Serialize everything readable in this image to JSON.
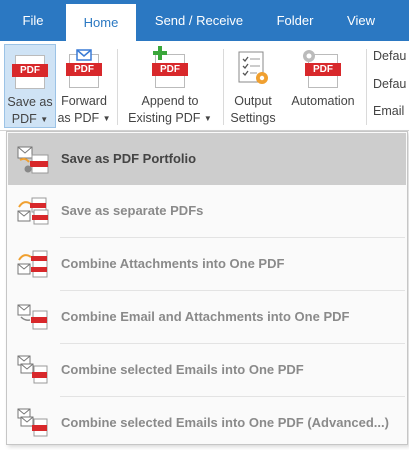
{
  "tabs": [
    {
      "label": "File"
    },
    {
      "label": "Home"
    },
    {
      "label": "Send / Receive"
    },
    {
      "label": "Folder"
    },
    {
      "label": "View"
    }
  ],
  "ribbon": {
    "save_as_pdf": {
      "line1": "Save as",
      "line2": "PDF"
    },
    "forward_as_pdf": {
      "line1": "Forward",
      "line2": "as PDF"
    },
    "append": {
      "line1": "Append to",
      "line2": "Existing PDF"
    },
    "output_settings": {
      "line1": "Output",
      "line2": "Settings"
    },
    "automation": {
      "line1": "Automation"
    },
    "pdf_badge": "PDF",
    "side_labels": [
      "Defau",
      "Defau",
      "Email"
    ]
  },
  "menu": {
    "items": [
      {
        "label": "Save as PDF Portfolio"
      },
      {
        "label": "Save as separate PDFs"
      },
      {
        "label": "Combine Attachments into One PDF"
      },
      {
        "label": "Combine Email and Attachments into One PDF"
      },
      {
        "label": "Combine selected Emails into One PDF"
      },
      {
        "label": "Combine selected Emails into One PDF (Advanced...)"
      }
    ]
  },
  "colors": {
    "accent": "#2b78c2",
    "pdf_red": "#d8282b",
    "highlight": "#cdcdcd"
  }
}
